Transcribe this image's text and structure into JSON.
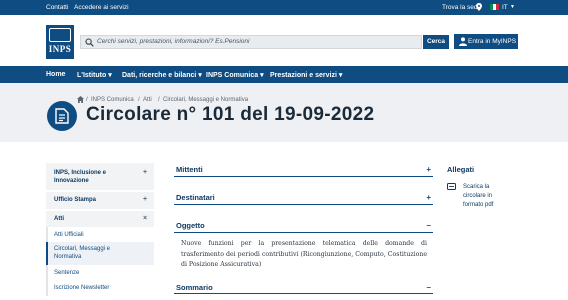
{
  "topbar": {
    "contatti": "Contatti",
    "servizi": "Accedere ai servizi",
    "sede": "Trova la sede",
    "lang": "IT",
    "flag_colors": [
      "#009246",
      "#ffffff",
      "#ce2b37"
    ]
  },
  "header": {
    "logo_text": "INPS",
    "search_placeholder": "Cerchi servizi, prestazioni, informazioni? Es.Pensioni",
    "search_button": "Cerca",
    "login_button": "Entra in MyINPS"
  },
  "nav": {
    "home": "Home",
    "istituto": "L'Istituto ▾",
    "dati": "Dati, ricerche e bilanci ▾",
    "comunica": "INPS Comunica ▾",
    "prestazioni": "Prestazioni e servizi ▾"
  },
  "breadcrumb": [
    "INPS Comunica",
    "Atti",
    "Circolari, Messaggi e Normativa"
  ],
  "page_title": "Circolare n° 101 del 19-09-2022",
  "sidebar": {
    "items": [
      {
        "label_line1": "INPS, Inclusione e",
        "label_line2": "Innovazione",
        "toggle": "+"
      },
      {
        "label_line1": "Ufficio Stampa",
        "toggle": "+"
      },
      {
        "label_line1": "Atti",
        "toggle": "×"
      }
    ],
    "subitems": [
      {
        "label": "Atti Ufficiali"
      },
      {
        "label_line1": "Circolari, Messaggi e",
        "label_line2": "Normativa"
      },
      {
        "label": "Sentenze"
      },
      {
        "label": "Iscrizione Newsletter"
      }
    ]
  },
  "sections": [
    {
      "title": "Mittenti",
      "toggle": "+"
    },
    {
      "title": "Destinatari",
      "toggle": "+"
    },
    {
      "title": "Oggetto",
      "toggle": "–"
    },
    {
      "title": "Sommario",
      "toggle": "–"
    }
  ],
  "oggetto_text": "Nuove funzioni per la presentazione telematica delle domande di trasferimento dei periodi contributivi (Ricongiunzione, Computo, Costituzione di Posizione Assicurativa)",
  "allegati": {
    "title": "Allegati",
    "link_line1": "Scarica la",
    "link_line2": "circolare in",
    "link_line3": "formato pdf"
  },
  "colors": {
    "brand": "#0f4c81",
    "band": "#eef0f3"
  }
}
